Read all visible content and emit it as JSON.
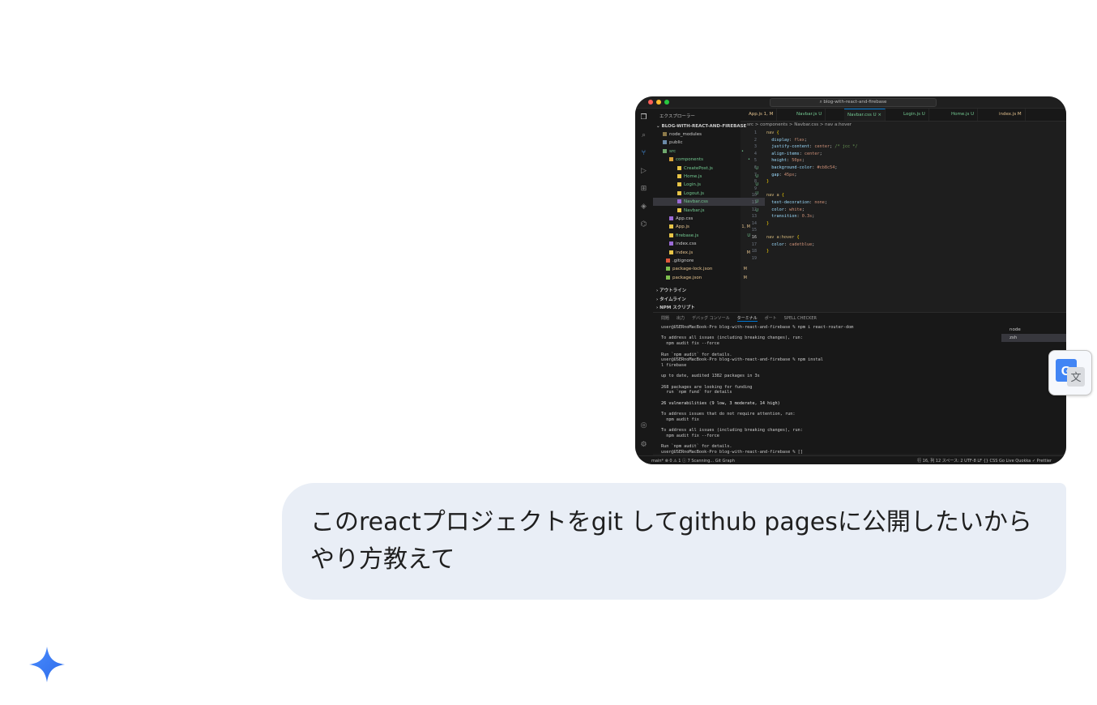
{
  "vscode": {
    "search_text": "blog-with-react-and-firebase",
    "explorer": {
      "title": "エクスプローラー",
      "root": "BLOG-WITH-REACT-AND-FIREBASE",
      "items": [
        {
          "label": "node_modules",
          "status": ""
        },
        {
          "label": "public",
          "status": ""
        },
        {
          "label": "src",
          "status": "•"
        },
        {
          "label": "components",
          "status": "•"
        },
        {
          "label": "CreatePost.js",
          "status": "U"
        },
        {
          "label": "Home.js",
          "status": "U"
        },
        {
          "label": "Login.js",
          "status": "U"
        },
        {
          "label": "Logout.js",
          "status": "U"
        },
        {
          "label": "Navbar.css",
          "status": "U"
        },
        {
          "label": "Navbar.js",
          "status": "U"
        },
        {
          "label": "App.css",
          "status": ""
        },
        {
          "label": "App.js",
          "status": "1, M"
        },
        {
          "label": "firebase.js",
          "status": "U"
        },
        {
          "label": "index.css",
          "status": ""
        },
        {
          "label": "index.js",
          "status": "M"
        },
        {
          "label": ".gitignore",
          "status": ""
        },
        {
          "label": "package-lock.json",
          "status": "M"
        },
        {
          "label": "package.json",
          "status": "M"
        }
      ],
      "sections": [
        "アウトライン",
        "タイムライン",
        "NPM スクリプト"
      ]
    },
    "tabs": [
      {
        "label": "App.js 1, M"
      },
      {
        "label": "Navbar.js U"
      },
      {
        "label": "Navbar.css U"
      },
      {
        "label": "Login.js U"
      },
      {
        "label": "Home.js U"
      },
      {
        "label": "index.js M"
      }
    ],
    "breadcrumb": "src > components > Navbar.css > nav a:hover",
    "code_lines": [
      "nav {",
      "  display: flex;",
      "  justify-content: center; /* jcc */",
      "  align-items: center;",
      "  height: 50px;",
      "  background-color: #cb8c54;",
      "  gap: 45px;",
      "}",
      "",
      "nav a {",
      "  text-decoration: none;",
      "  color: white;",
      "  transition: 0.3s;",
      "}",
      "",
      "nav a:hover {",
      "  color: cadetblue;",
      "}",
      ""
    ],
    "panel_tabs": [
      "問題",
      "出力",
      "デバッグ コンソール",
      "ターミナル",
      "ポート",
      "SPELL CHECKER"
    ],
    "problems_count": "9",
    "spell_count": "9",
    "terminal_lines": [
      "user@USERnoMacBook-Pro blog-with-react-and-firebase % npm i react-router-dom",
      "",
      "To address all issues (including breaking changes), run:",
      "  npm audit fix --force",
      "",
      "Run `npm audit` for details.",
      "user@USERnoMacBook-Pro blog-with-react-and-firebase % npm instal",
      "l firebase",
      "",
      "up to date, audited 1382 packages in 3s",
      "",
      "268 packages are looking for funding",
      "  run `npm fund` for details",
      "",
      "26 vulnerabilities (9 low, 3 moderate, 14 high)",
      "",
      "To address issues that do not require attention, run:",
      "  npm audit fix",
      "",
      "To address all issues (including breaking changes), run:",
      "  npm audit fix --force",
      "",
      "Run `npm audit` for details.",
      "user@USERnoMacBook-Pro blog-with-react-and-firebase % []"
    ],
    "terminal_list": [
      "node",
      "zsh"
    ],
    "status_left": "main*  ⊗ 0 ⚠ 1 ⓘ 7   Scanning...   Git Graph",
    "status_right": "行 16, 列 12   スペース: 2   UTF-8   LF   {} CSS   Go Live   Quokka   ✓ Prettier"
  },
  "message": "このreactプロジェクトをgit してgithub pagesに公開したいからやり方教えて",
  "colors": {
    "bubble": "#e9eef6",
    "accent_blue": "#4285f4",
    "editor_bg": "#1e1e1e"
  }
}
